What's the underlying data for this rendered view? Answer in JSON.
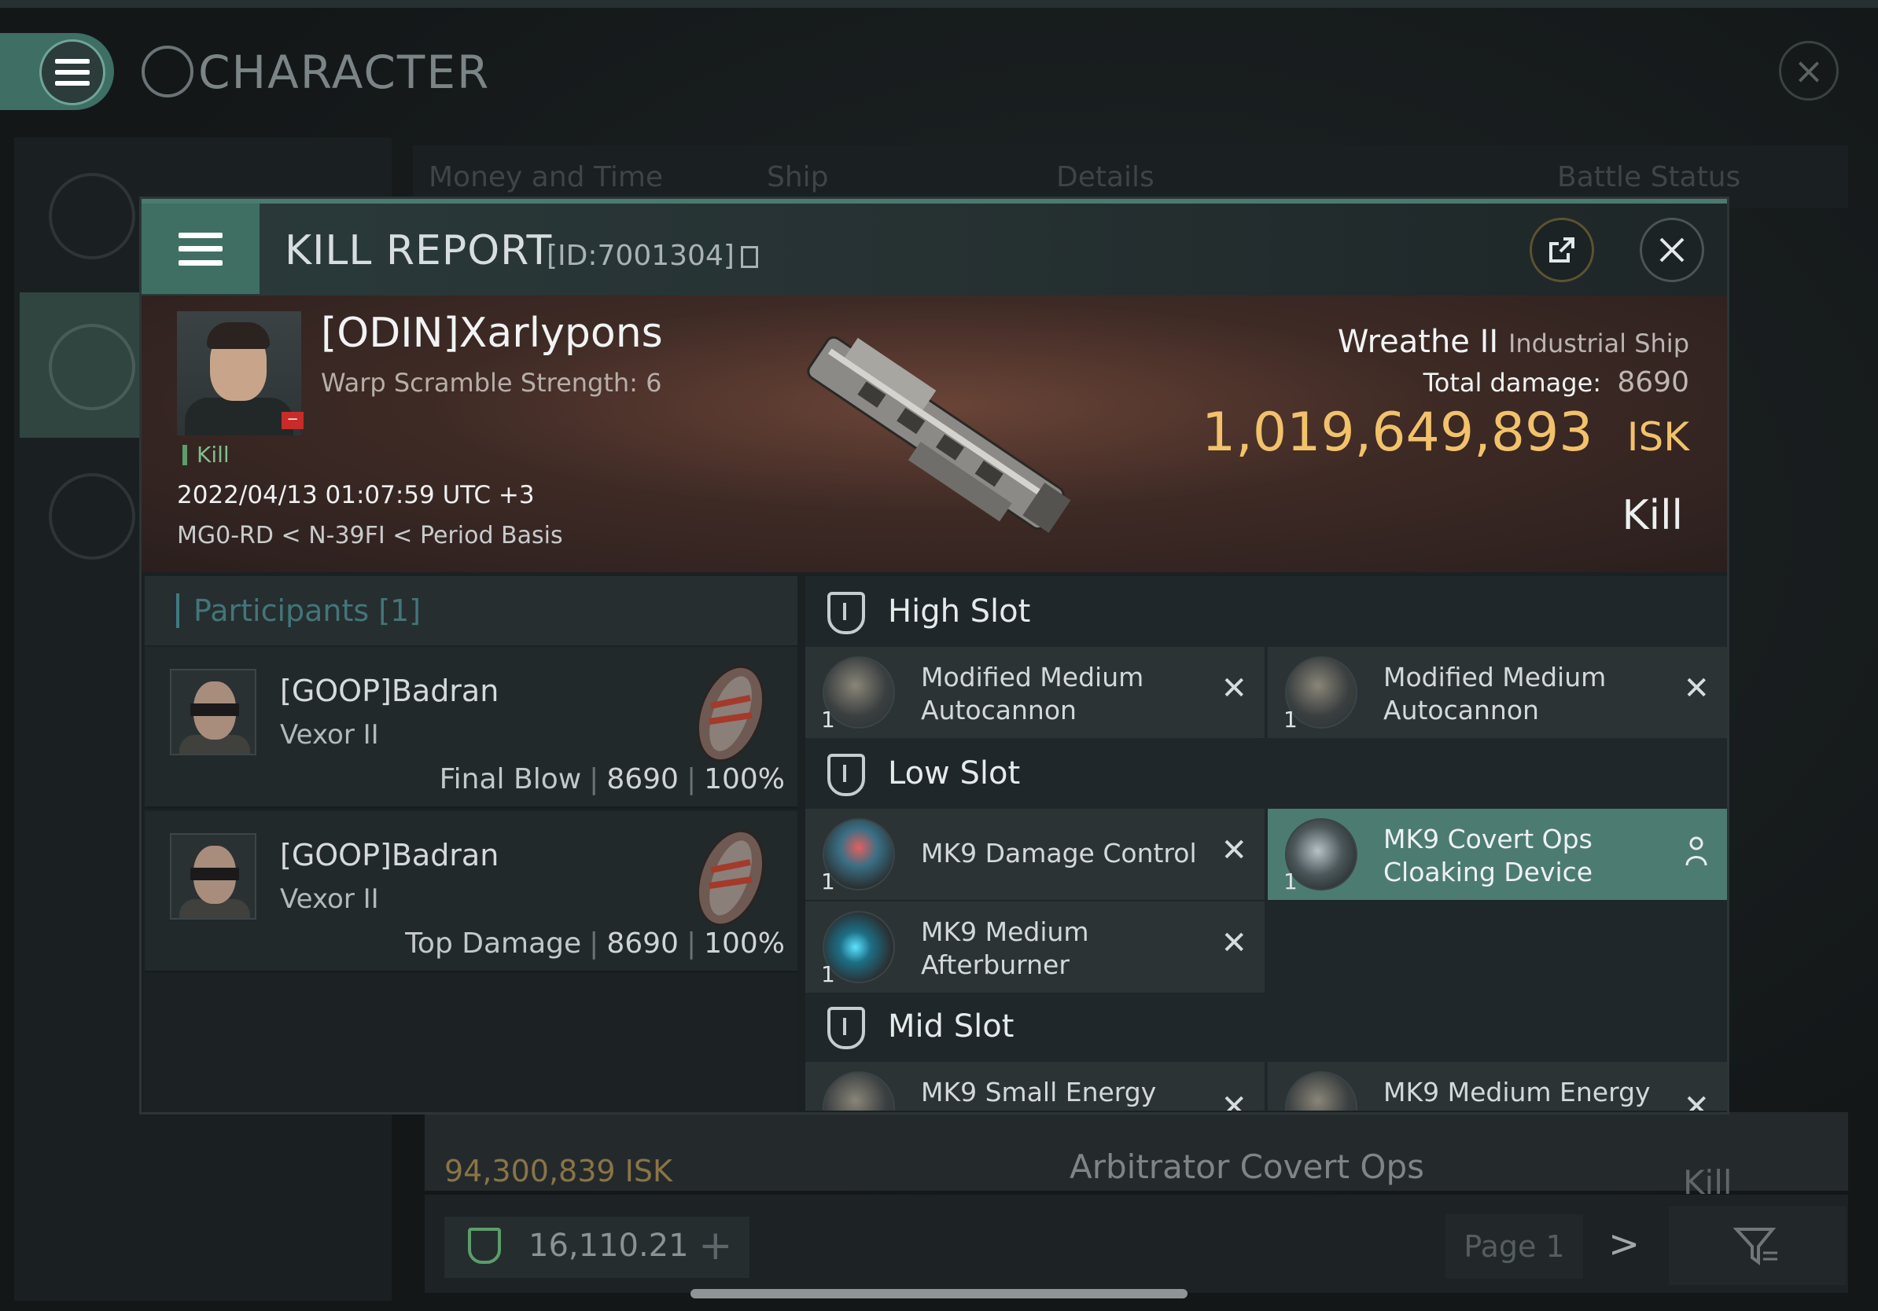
{
  "background": {
    "window_title": "CHARACTER",
    "tabs": [
      "Money and Time",
      "Ship",
      "Details",
      "Battle Status"
    ],
    "row": {
      "isk": "94,300,839",
      "isk_unit": "ISK",
      "ship": "Arbitrator Covert Ops",
      "result": "Kill"
    },
    "wallet": "16,110.21",
    "page": "Page 1"
  },
  "kill_report": {
    "title": "KILL REPORT",
    "id": "[ID:7001304]",
    "victim": {
      "name": "[ODIN]Xarlypons",
      "warp_scramble": "Warp Scramble Strength: 6",
      "tag": "Kill",
      "datetime": "2022/04/13 01:07:59 UTC +3",
      "location": "MG0-RD < N-39FI < Period Basis"
    },
    "ship": {
      "name": "Wreathe II",
      "class": "Industrial Ship",
      "total_damage_label": "Total damage:",
      "total_damage": "8690",
      "isk_value": "1,019,649,893",
      "isk_unit": "ISK",
      "result": "Kill"
    },
    "participants": {
      "title": "Participants [1]",
      "rows": [
        {
          "name": "[GOOP]Badran",
          "ship": "Vexor II",
          "role": "Final Blow",
          "damage": "8690",
          "percent": "100%"
        },
        {
          "name": "[GOOP]Badran",
          "ship": "Vexor II",
          "role": "Top Damage",
          "damage": "8690",
          "percent": "100%"
        }
      ]
    },
    "slots": {
      "high": {
        "title": "High Slot",
        "items": [
          {
            "name": "Modified Medium Autocannon",
            "qty": "1"
          },
          {
            "name": "Modified Medium Autocannon",
            "qty": "1"
          }
        ]
      },
      "low": {
        "title": "Low Slot",
        "items": [
          {
            "name": "MK9 Damage Control",
            "qty": "1"
          },
          {
            "name": "MK9 Covert Ops Cloaking Device",
            "qty": "1"
          },
          {
            "name": "MK9 Medium Afterburner",
            "qty": "1"
          }
        ]
      },
      "mid": {
        "title": "Mid Slot",
        "items": [
          {
            "name": "MK9 Small Energy"
          },
          {
            "name": "MK9 Medium Energy"
          }
        ]
      }
    }
  },
  "colors": {
    "accent": "#4b7a6e",
    "isk_gold": "#f2c26b",
    "kill_green": "#7fbf8b",
    "selected_item": "#4c7b72"
  }
}
